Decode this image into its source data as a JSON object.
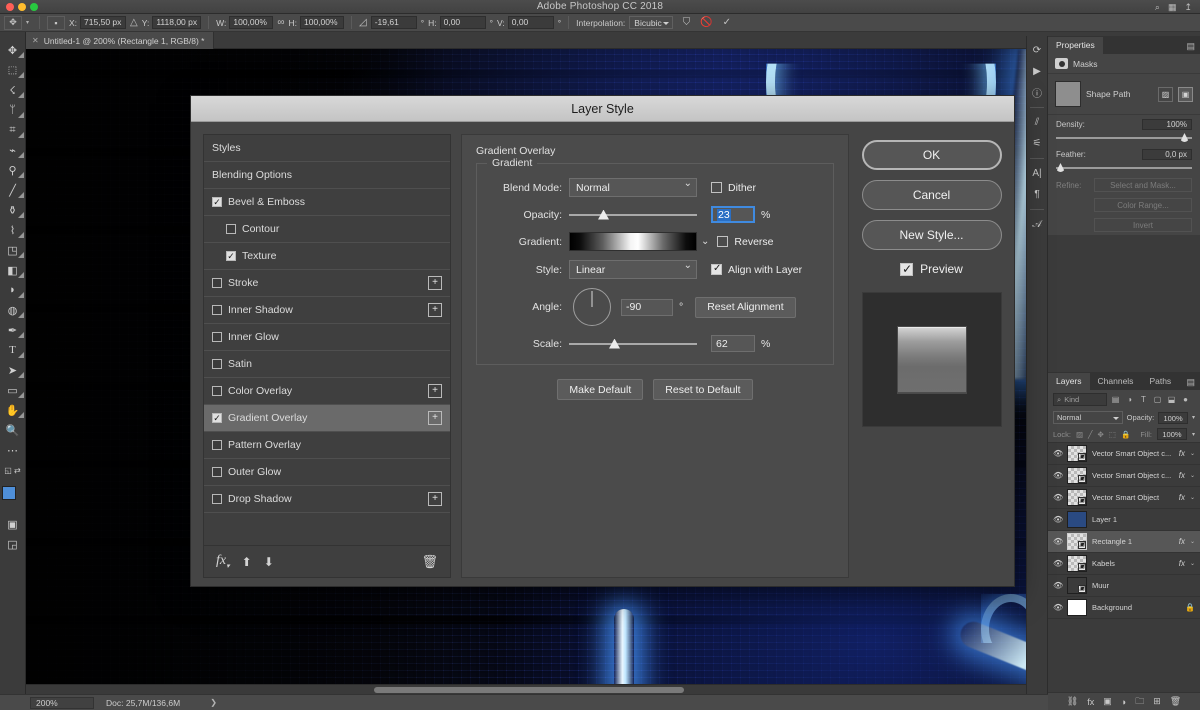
{
  "window": {
    "app_title": "Adobe Photoshop CC 2018"
  },
  "options_bar": {
    "tool_icon": "move-tool-icon",
    "reference_point_label": "",
    "x_label": "X:",
    "x_value": "715,50 px",
    "delta_icon": "delta-icon",
    "y_label": "Y:",
    "y_value": "1118,00 px",
    "w_label": "W:",
    "w_value": "100,00%",
    "link_icon": "link-icon",
    "h_label": "H:",
    "h_value": "100,00%",
    "angle_icon": "angle-icon",
    "angle_value": "-19,61",
    "deg_symbol": "°",
    "skew_h_label": "H:",
    "skew_h_value": "0,00",
    "skew_v_label": "V:",
    "skew_v_value": "0,00",
    "interpolation_label": "Interpolation:",
    "interpolation_value": "Bicubic",
    "warp_icon": "warp-icon",
    "cancel_icon": "cancel-transform-icon",
    "commit_icon": "commit-transform-icon"
  },
  "document_tab": {
    "close_icon": "close-tab-icon",
    "title": "Untitled-1 @ 200% (Rectangle 1, RGB/8) *"
  },
  "toolbar": {
    "tools": [
      {
        "name": "move-tool-icon",
        "glyph": "✥"
      },
      {
        "name": "rectangular-marquee-tool-icon",
        "glyph": "▭"
      },
      {
        "name": "lasso-tool-icon",
        "glyph": "☇"
      },
      {
        "name": "magic-wand-tool-icon",
        "glyph": "✎"
      },
      {
        "name": "crop-tool-icon",
        "glyph": "⌗"
      },
      {
        "name": "eyedropper-tool-icon",
        "glyph": "⌁"
      },
      {
        "name": "spot-healing-brush-tool-icon",
        "glyph": "⚭"
      },
      {
        "name": "brush-tool-icon",
        "glyph": "🖌"
      },
      {
        "name": "clone-stamp-tool-icon",
        "glyph": "⎍"
      },
      {
        "name": "history-brush-tool-icon",
        "glyph": "⌇"
      },
      {
        "name": "eraser-tool-icon",
        "glyph": "◻"
      },
      {
        "name": "gradient-tool-icon",
        "glyph": "◨"
      },
      {
        "name": "blur-tool-icon",
        "glyph": "💧"
      },
      {
        "name": "dodge-tool-icon",
        "glyph": "⬭"
      },
      {
        "name": "pen-tool-icon",
        "glyph": "✒"
      },
      {
        "name": "type-tool-icon",
        "glyph": "T"
      },
      {
        "name": "path-selection-tool-icon",
        "glyph": "➤"
      },
      {
        "name": "rectangle-tool-icon",
        "glyph": "▭"
      },
      {
        "name": "hand-tool-icon",
        "glyph": "✋"
      },
      {
        "name": "zoom-tool-icon",
        "glyph": "🔍"
      },
      {
        "name": "edit-toolbar-icon",
        "glyph": "···"
      }
    ],
    "quickmask_icon": "quick-mask-icon",
    "screenmode_icon": "screen-mode-icon"
  },
  "dialog": {
    "title": "Layer Style",
    "styles": [
      {
        "label": "Styles",
        "checkbox": false,
        "checked": false,
        "indent": false,
        "plus": false,
        "active": false
      },
      {
        "label": "Blending Options",
        "checkbox": false,
        "checked": false,
        "indent": false,
        "plus": false,
        "active": false
      },
      {
        "label": "Bevel & Emboss",
        "checkbox": true,
        "checked": true,
        "indent": false,
        "plus": false,
        "active": false
      },
      {
        "label": "Contour",
        "checkbox": true,
        "checked": false,
        "indent": true,
        "plus": false,
        "active": false
      },
      {
        "label": "Texture",
        "checkbox": true,
        "checked": true,
        "indent": true,
        "plus": false,
        "active": false
      },
      {
        "label": "Stroke",
        "checkbox": true,
        "checked": false,
        "indent": false,
        "plus": true,
        "active": false
      },
      {
        "label": "Inner Shadow",
        "checkbox": true,
        "checked": false,
        "indent": false,
        "plus": true,
        "active": false
      },
      {
        "label": "Inner Glow",
        "checkbox": true,
        "checked": false,
        "indent": false,
        "plus": false,
        "active": false
      },
      {
        "label": "Satin",
        "checkbox": true,
        "checked": false,
        "indent": false,
        "plus": false,
        "active": false
      },
      {
        "label": "Color Overlay",
        "checkbox": true,
        "checked": false,
        "indent": false,
        "plus": true,
        "active": false
      },
      {
        "label": "Gradient Overlay",
        "checkbox": true,
        "checked": true,
        "indent": false,
        "plus": true,
        "active": true
      },
      {
        "label": "Pattern Overlay",
        "checkbox": true,
        "checked": false,
        "indent": false,
        "plus": false,
        "active": false
      },
      {
        "label": "Outer Glow",
        "checkbox": true,
        "checked": false,
        "indent": false,
        "plus": false,
        "active": false
      },
      {
        "label": "Drop Shadow",
        "checkbox": true,
        "checked": false,
        "indent": false,
        "plus": true,
        "active": false
      }
    ],
    "styles_footer": {
      "fx_icon": "fx-icon",
      "up_icon": "move-up-icon",
      "down_icon": "move-down-icon",
      "trash_icon": "delete-icon"
    },
    "settings": {
      "section_title": "Gradient Overlay",
      "group_legend": "Gradient",
      "blend_mode_label": "Blend Mode:",
      "blend_mode_value": "Normal",
      "dither_label": "Dither",
      "dither_checked": false,
      "opacity_label": "Opacity:",
      "opacity_value": "23",
      "opacity_unit": "%",
      "gradient_label": "Gradient:",
      "reverse_label": "Reverse",
      "reverse_checked": false,
      "style_label": "Style:",
      "style_value": "Linear",
      "align_label": "Align with Layer",
      "align_checked": true,
      "angle_label": "Angle:",
      "angle_value": "-90",
      "angle_unit": "°",
      "reset_alignment_label": "Reset Alignment",
      "scale_label": "Scale:",
      "scale_value": "62",
      "scale_unit": "%",
      "make_default_label": "Make Default",
      "reset_to_default_label": "Reset to Default"
    },
    "actions": {
      "ok_label": "OK",
      "cancel_label": "Cancel",
      "new_style_label": "New Style...",
      "preview_label": "Preview",
      "preview_checked": true
    }
  },
  "properties_panel": {
    "tab_label": "Properties",
    "menu_icon": "panel-menu-icon",
    "masks_label": "Masks",
    "masks_icon": "mask-icon",
    "shape_path_label": "Shape Path",
    "pixel_mask_icon": "pixel-mask-icon",
    "vector_mask_icon": "vector-mask-icon",
    "density_label": "Density:",
    "density_value": "100%",
    "feather_label": "Feather:",
    "feather_value": "0,0 px",
    "refine_label": "Refine:",
    "select_and_mask_label": "Select and Mask...",
    "color_range_label": "Color Range...",
    "invert_label": "Invert"
  },
  "layers_panel": {
    "tabs": [
      "Layers",
      "Channels",
      "Paths"
    ],
    "active_tab": "Layers",
    "menu_icon": "panel-menu-icon",
    "filter_placeholder": "Kind",
    "filter_icon": "search-icon",
    "filter_type_icons": [
      "pixel-filter-icon",
      "adjustment-filter-icon",
      "type-filter-icon",
      "shape-filter-icon",
      "smart-object-filter-icon"
    ],
    "filter_toggle_icon": "filter-toggle-icon",
    "blend_mode": "Normal",
    "opacity_label": "Opacity:",
    "opacity_value": "100%",
    "lock_label": "Lock:",
    "lock_icons": [
      "lock-transparency-icon",
      "lock-image-icon",
      "lock-position-icon",
      "lock-artboard-icon",
      "lock-all-icon"
    ],
    "fill_label": "Fill:",
    "fill_value": "100%",
    "layers": [
      {
        "name": "Vector Smart Object c...",
        "visible": true,
        "fx": true,
        "selected": false,
        "thumb": "checker",
        "badge": "smart"
      },
      {
        "name": "Vector Smart Object c...",
        "visible": true,
        "fx": true,
        "selected": false,
        "thumb": "checker",
        "badge": "smart"
      },
      {
        "name": "Vector Smart Object",
        "visible": true,
        "fx": true,
        "selected": false,
        "thumb": "checker",
        "badge": "smart"
      },
      {
        "name": "Layer 1",
        "visible": true,
        "fx": false,
        "selected": false,
        "thumb": "cloud",
        "badge": ""
      },
      {
        "name": "Rectangle 1",
        "visible": true,
        "fx": true,
        "selected": true,
        "thumb": "checker",
        "badge": "vector"
      },
      {
        "name": "Kabels",
        "visible": true,
        "fx": true,
        "selected": false,
        "thumb": "checker",
        "badge": "smart"
      },
      {
        "name": "Muur",
        "visible": true,
        "fx": false,
        "selected": false,
        "thumb": "dark",
        "badge": "smart"
      },
      {
        "name": "Background",
        "visible": true,
        "fx": false,
        "selected": false,
        "thumb": "white",
        "badge": "",
        "locked": true
      }
    ],
    "footer_icons": [
      "link-layers-icon",
      "add-style-icon",
      "add-mask-icon",
      "adjustment-layer-icon",
      "new-group-icon",
      "new-layer-icon",
      "delete-layer-icon"
    ]
  },
  "status_bar": {
    "zoom": "200%",
    "doc_info": "Doc: 25,7M/136,6M",
    "expand_icon": "expand-status-icon"
  }
}
